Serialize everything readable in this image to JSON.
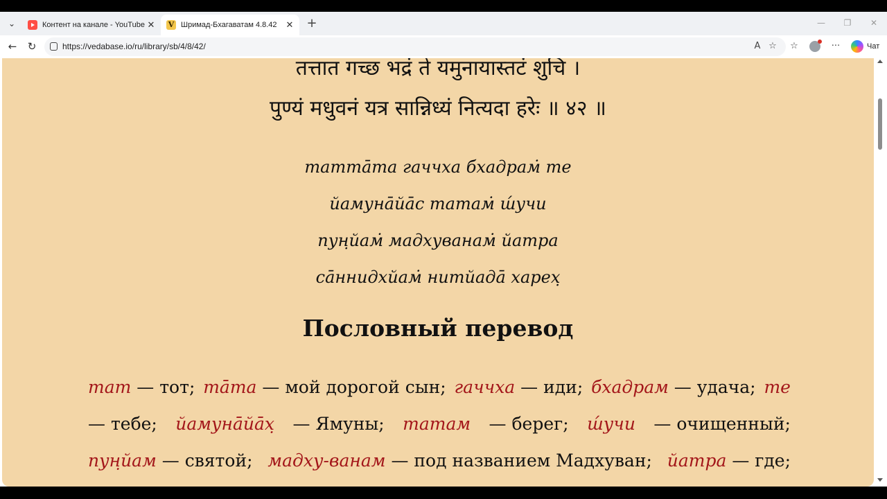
{
  "browser": {
    "tabs": [
      {
        "title": "Контент на канале - YouTube Studio",
        "active": false,
        "favicon": "youtube-studio-icon"
      },
      {
        "title": "Шримад-Бхагаватам 4.8.42",
        "active": true,
        "favicon": "vedabase-icon"
      }
    ],
    "url": "https://vedabase.io/ru/library/sb/4/8/42/",
    "chat_label": "Чат"
  },
  "verse": {
    "devanagari": [
      "तत्तात गच्छ भद्रं ते यमुनायास्तटं शुचि ।",
      "पुण्यं मधुवनं यत्र सान्निध्यं नित्यदा हरेः ॥ ४२ ॥"
    ],
    "transliteration": [
      "татта̄та гаччха бхадрам̇ те",
      "йамуна̄йа̄с татам̇ ш́учи",
      "пун̣йам̇ мадхуванам̇ йатра",
      "са̄ннидхйам̇ нитйада̄ харех̣"
    ]
  },
  "synonyms": {
    "heading": "Пословный перевод",
    "lines": [
      [
        {
          "term": "тат",
          "meaning": "— тот;"
        },
        {
          "term": "та̄та",
          "meaning": "— мой дорогой сын;"
        },
        {
          "term": "гаччха",
          "meaning": "— иди;"
        },
        {
          "term": "бхадрам",
          "meaning": "— удача;"
        },
        {
          "term": "те",
          "meaning": ""
        }
      ],
      [
        {
          "term": "",
          "meaning": "— тебе;"
        },
        {
          "term": "йамуна̄йа̄х̣",
          "meaning": "— Ямуны;"
        },
        {
          "term": "татам",
          "meaning": "— берег;"
        },
        {
          "term": "ш́учи",
          "meaning": "— очищенный;"
        }
      ],
      [
        {
          "term": "пун̣йам",
          "meaning": "— святой;"
        },
        {
          "term": "мадху-ванам",
          "meaning": "— под названием Мадхуван;"
        },
        {
          "term": "йатра",
          "meaning": "— где;"
        }
      ]
    ]
  }
}
